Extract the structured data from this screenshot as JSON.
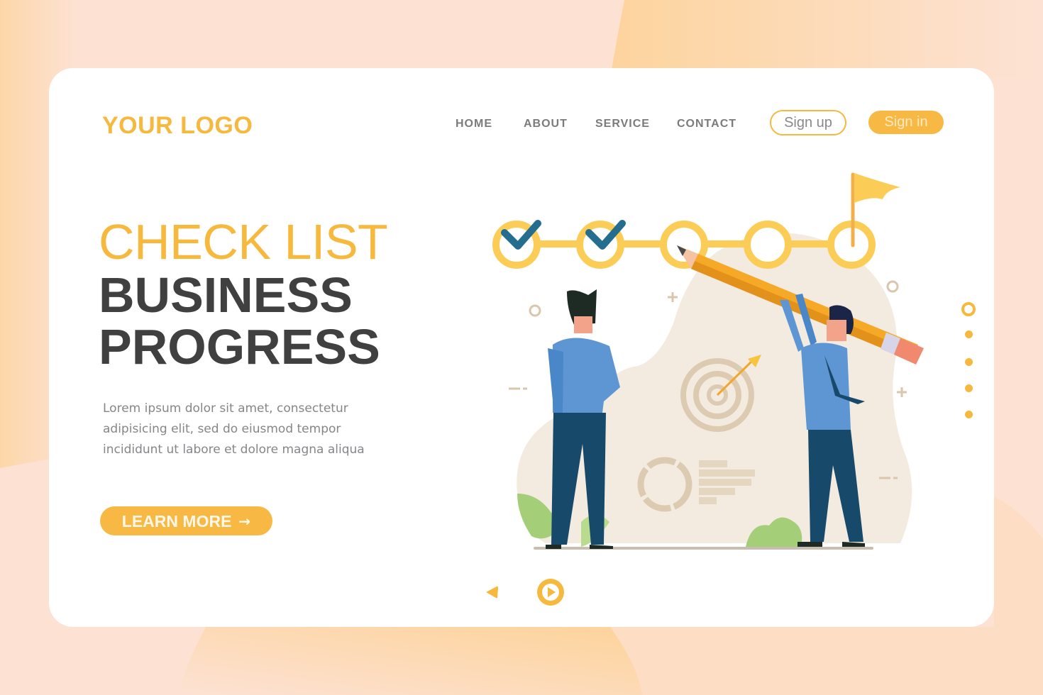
{
  "colors": {
    "accent": "#f6b83d",
    "heading_dark": "#404040",
    "nav_text": "#7b7b7e",
    "check_blue": "#256d8f",
    "background": "#fde2d4"
  },
  "header": {
    "logo": "YOUR LOGO",
    "nav": [
      {
        "label": "HOME"
      },
      {
        "label": "ABOUT"
      },
      {
        "label": "SERVICE"
      },
      {
        "label": "CONTACT"
      }
    ],
    "signup_label": "Sign up",
    "signin_label": "Sign in"
  },
  "hero": {
    "title_line1": "CHECK LIST",
    "title_line2": "BUSINESS",
    "title_line3": "PROGRESS",
    "description": "Lorem ipsum dolor sit amet, consectetur adipisicing elit, sed do eiusmod tempor incididunt ut labore et dolore magna aliqua",
    "cta_label": "LEARN MORE",
    "cta_icon": "arrow-right-icon",
    "cta_arrow": "→"
  },
  "illustration": {
    "checklist_steps": [
      {
        "done": true
      },
      {
        "done": true
      },
      {
        "done": false
      },
      {
        "done": false
      },
      {
        "done": false,
        "flag": true
      }
    ],
    "icons": [
      "check-icon",
      "flag-icon",
      "pencil-icon",
      "target-icon",
      "donut-chart-icon",
      "bar-list-icon",
      "person-icon",
      "plant-icon"
    ]
  },
  "pagination": {
    "total": 5,
    "active_index": 0
  },
  "slider_controls": {
    "prev_icon": "triangle-left-icon",
    "play_icon": "play-circle-icon"
  }
}
